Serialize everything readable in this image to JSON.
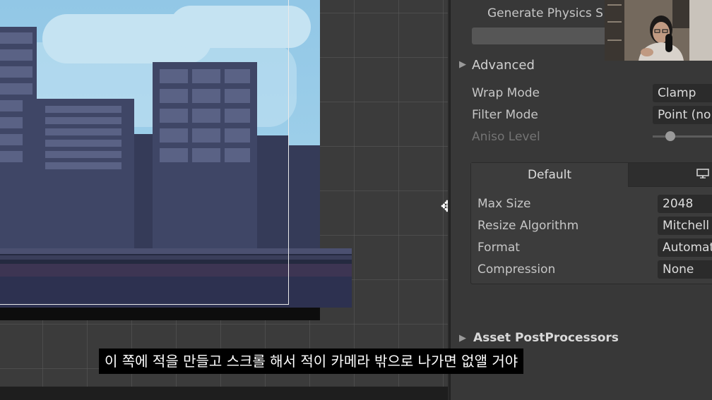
{
  "inspector": {
    "generate_physics_label": "Generate Physics S",
    "advanced_label": "Advanced",
    "wrap_mode_label": "Wrap Mode",
    "wrap_mode_value": "Clamp",
    "filter_mode_label": "Filter Mode",
    "filter_mode_value": "Point (no",
    "aniso_level_label": "Aniso Level",
    "platform_tabs": {
      "default_label": "Default",
      "pc_icon": "monitor-icon"
    },
    "max_size_label": "Max Size",
    "max_size_value": "2048",
    "resize_algorithm_label": "Resize Algorithm",
    "resize_algorithm_value": "Mitchell",
    "format_label": "Format",
    "format_value": "Automat",
    "compression_label": "Compression",
    "compression_value": "None",
    "asset_postprocessors_label": "Asset PostProcessors"
  },
  "subtitle": {
    "text": "이 쪽에 적을 만들고 스크롤 해서 적이 카메라 밖으로 나가면 없앨 거야"
  },
  "colors": {
    "inspector_bg": "#383838",
    "scene_bg": "#3b3b3b",
    "sky": "#9fd0ea",
    "building": "#3f4666"
  }
}
